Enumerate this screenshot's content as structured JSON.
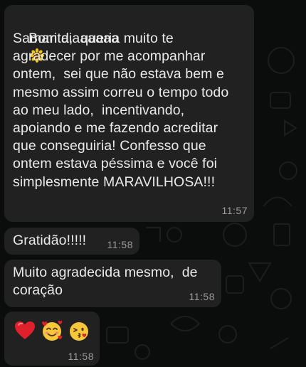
{
  "chat": {
    "messages": [
      {
        "text": "Bom diaaaaaa",
        "body": "Samarita,  queria muito te\nagradecer por me acompanhar\nontem,  sei que não estava bem e\nmesmo assim correu o tempo todo\nao meu lado,  incentivando,\napoiando e me fazendo acreditar\nque conseguiria! Confesso que\nontem estava péssima e você foi\nsimplesmente MARAVILHOSA!!!",
        "time": "11:57"
      },
      {
        "text": "Gratidão!!!!!",
        "time": "11:58"
      },
      {
        "text": "Muito agradecida mesmo,  de\ncoração",
        "time": "11:58"
      },
      {
        "emojis": [
          "red-heart",
          "smiling-face-with-hearts",
          "face-blowing-kiss"
        ],
        "time": "11:58"
      }
    ]
  },
  "colors": {
    "background": "#0b0d0c",
    "bubble": "#212122",
    "text": "#eaeaea",
    "timestamp": "#9a9c9b"
  }
}
